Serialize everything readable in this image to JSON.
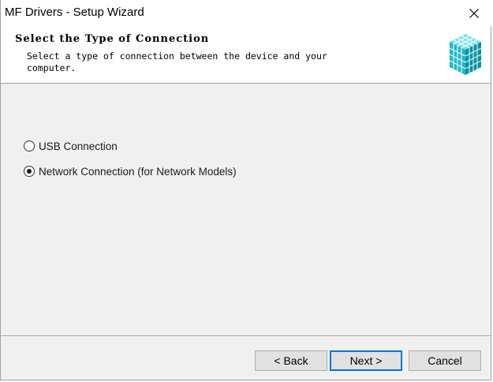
{
  "window": {
    "title": "MF Drivers - Setup Wizard"
  },
  "header": {
    "heading": "Select the Type of Connection",
    "subheading": "Select a type of connection between the device and your computer.",
    "logo_icon": "cube-stack-icon",
    "logo_colors": [
      "#1fb8c9",
      "#4fd6e0",
      "#0e8fa3",
      "#7ae3ea"
    ]
  },
  "options": [
    {
      "label": "USB Connection",
      "checked": false
    },
    {
      "label": "Network Connection (for Network Models)",
      "checked": true
    }
  ],
  "buttons": {
    "back": "< Back",
    "next": "Next >",
    "cancel": "Cancel"
  },
  "colors": {
    "focus_border": "#0078d7",
    "button_face": "#e1e1e1",
    "dialog_bg": "#f0f0f0"
  }
}
